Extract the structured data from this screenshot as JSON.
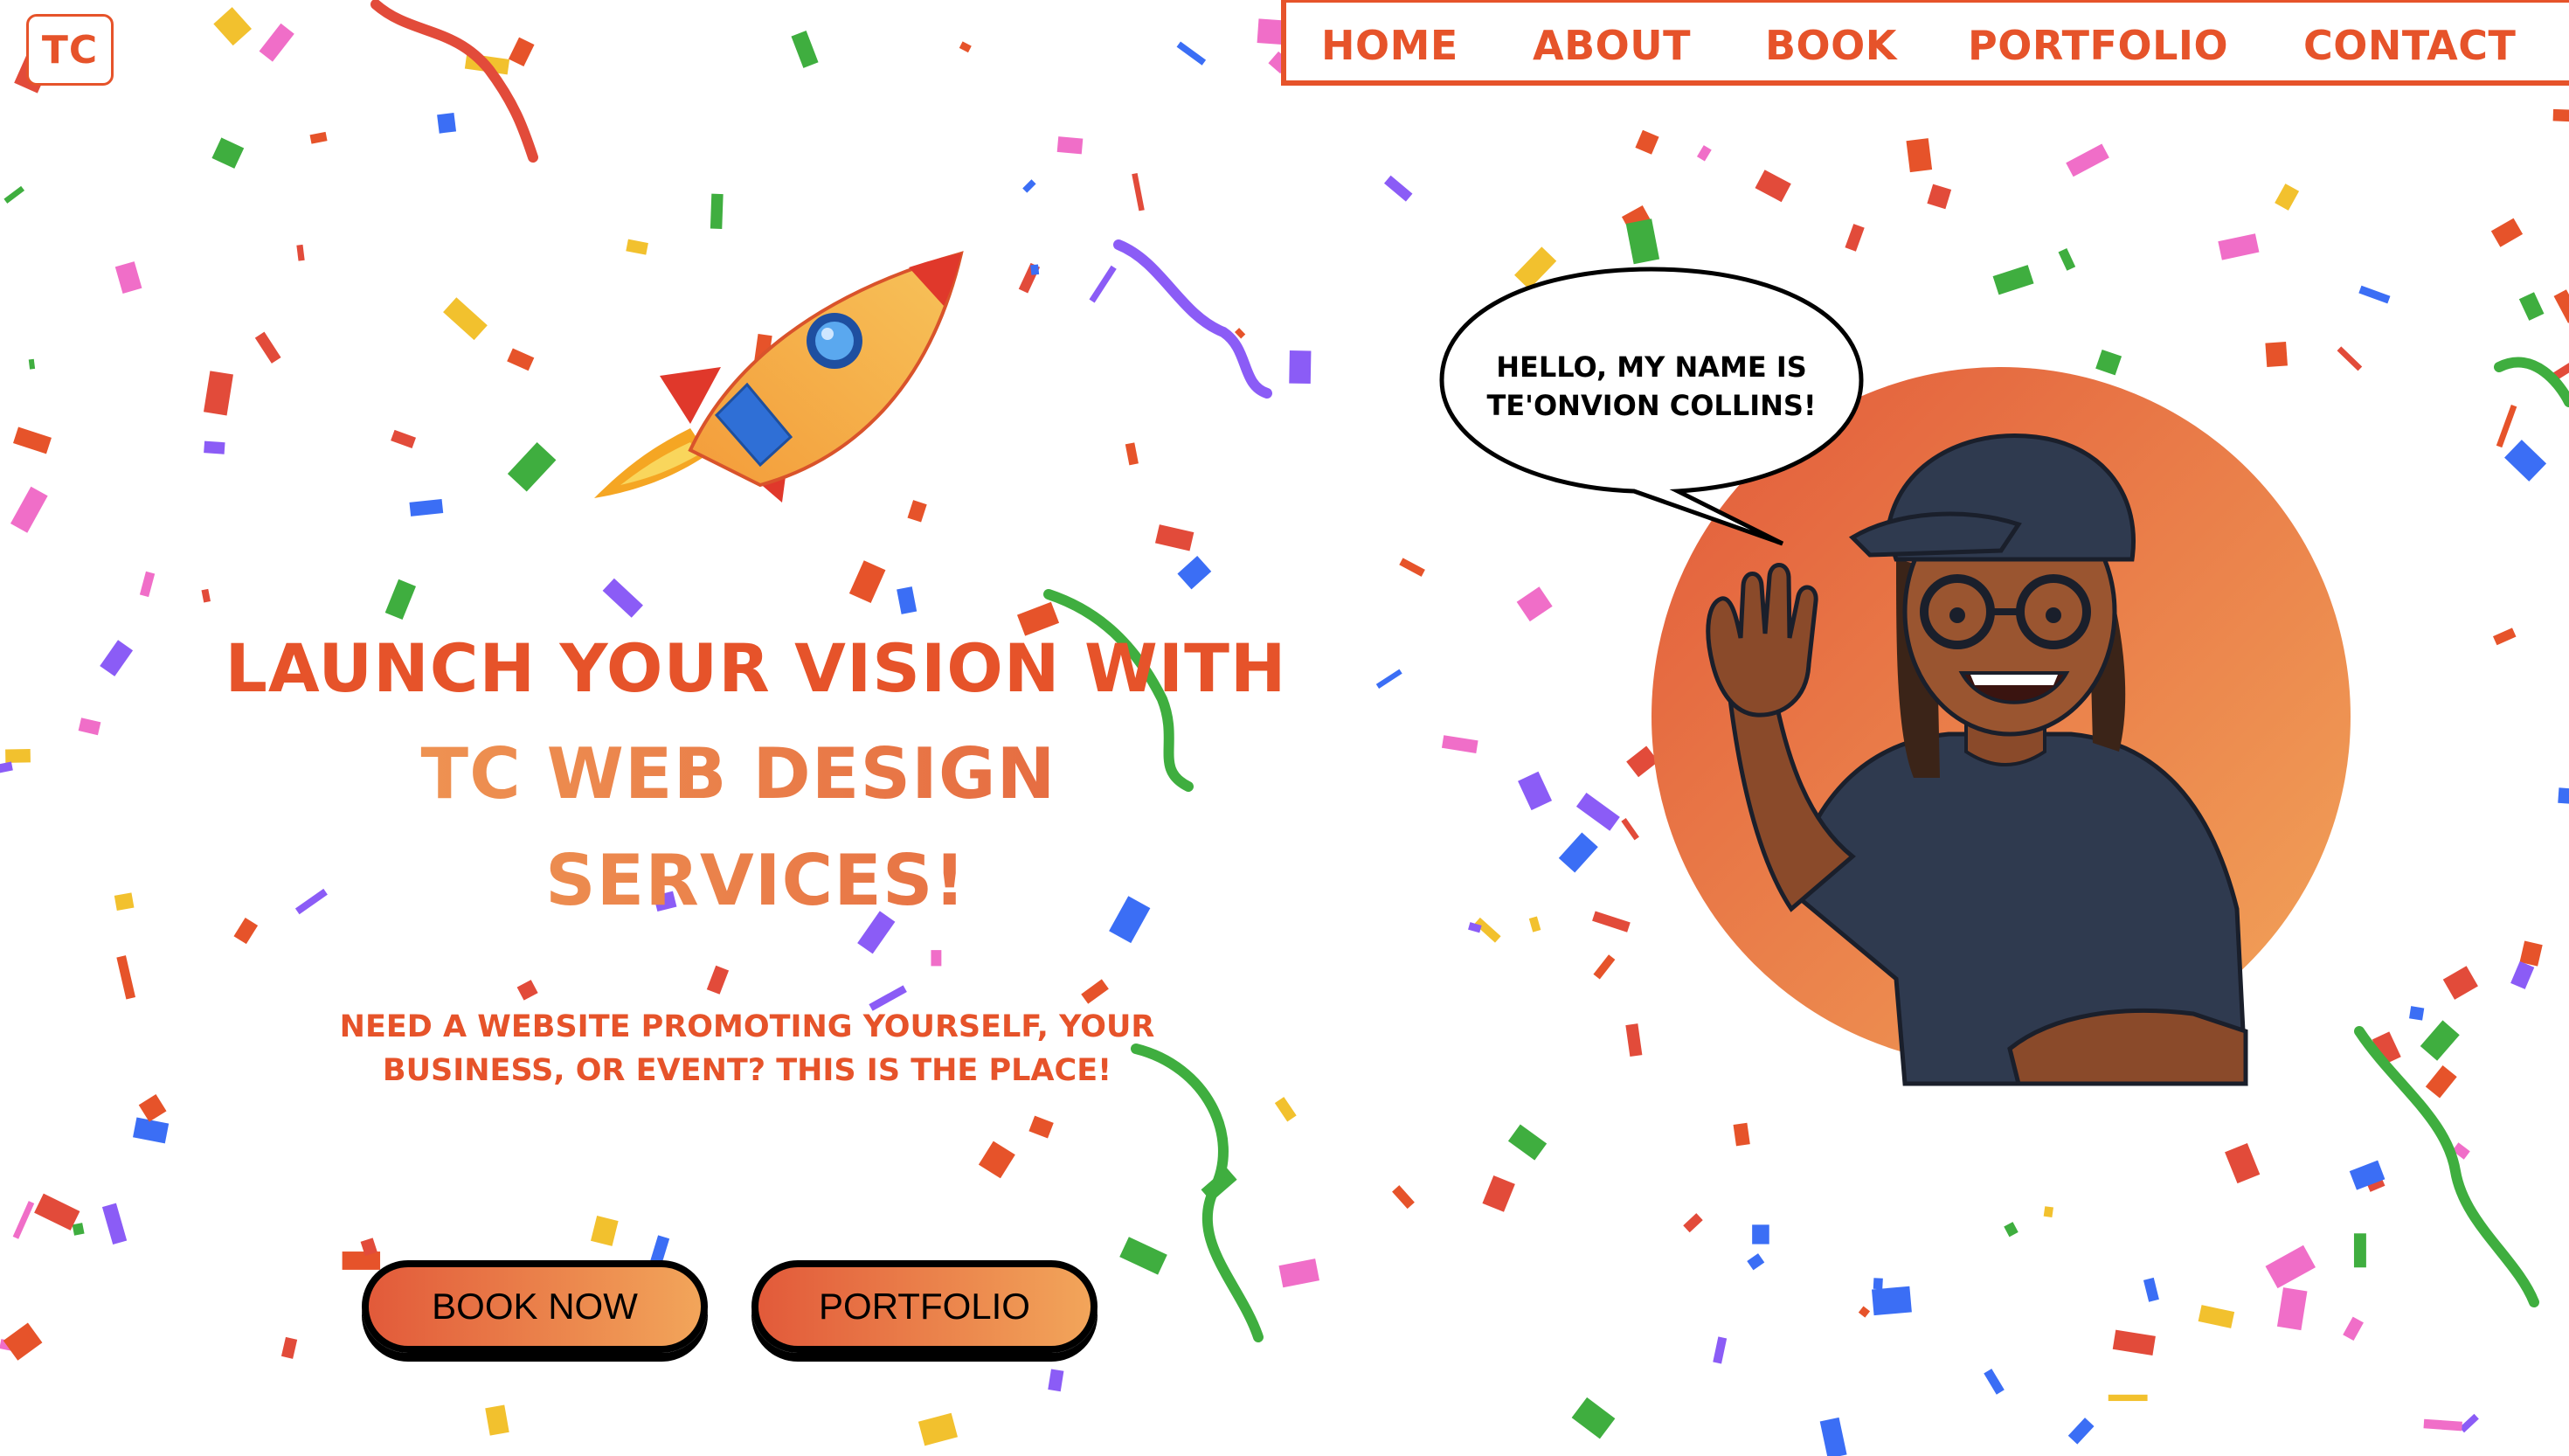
{
  "logo": {
    "text": "TC"
  },
  "nav": {
    "items": [
      "HOME",
      "ABOUT",
      "BOOK",
      "PORTFOLIO",
      "CONTACT"
    ]
  },
  "hero": {
    "headline_line1": "LAUNCH YOUR VISION WITH",
    "headline_line2": "TC WEB DESIGN",
    "headline_line3": "SERVICES!",
    "subtext_line1": "NEED A WEBSITE PROMOTING YOURSELF, YOUR",
    "subtext_line2": "BUSINESS, OR EVENT? THIS IS THE PLACE!",
    "buttons": {
      "book": "BOOK NOW",
      "portfolio": "PORTFOLIO"
    }
  },
  "speech_bubble": {
    "line1": "HELLO, MY NAME IS",
    "line2": "TE'ONVION COLLINS!"
  },
  "colors": {
    "accent": "#e6532a",
    "gradient_start": "#e25a3a",
    "gradient_end": "#f2a55a",
    "shirt": "#2f3a4f"
  },
  "icons": [
    "rocket-icon",
    "avatar-illustration",
    "confetti"
  ]
}
